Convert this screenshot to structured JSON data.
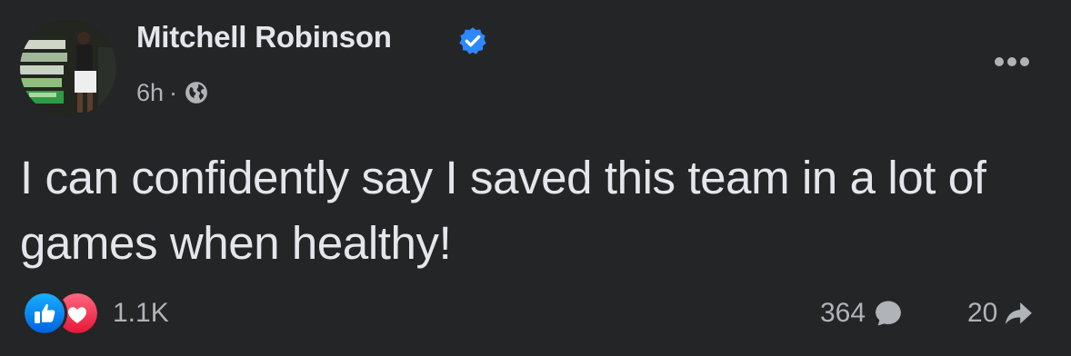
{
  "post": {
    "author": "Mitchell Robinson",
    "time": "6h",
    "separator": "·",
    "audience_icon": "globe-icon",
    "verified_icon": "verified-badge-icon",
    "more_icon": "more-options-icon",
    "text": "I can confidently say I saved this team in a lot of games when healthy!",
    "reactions": {
      "icons": [
        "like-reaction-icon",
        "love-reaction-icon"
      ],
      "count": "1.1K"
    },
    "comments_count": "364",
    "shares_count": "20"
  },
  "colors": {
    "background": "#242526",
    "primary_text": "#e4e6eb",
    "secondary_text": "#b0b3b8",
    "verified_blue": "#2d88ff",
    "like_blue": "#1877f2",
    "love_red": "#f33e58"
  }
}
